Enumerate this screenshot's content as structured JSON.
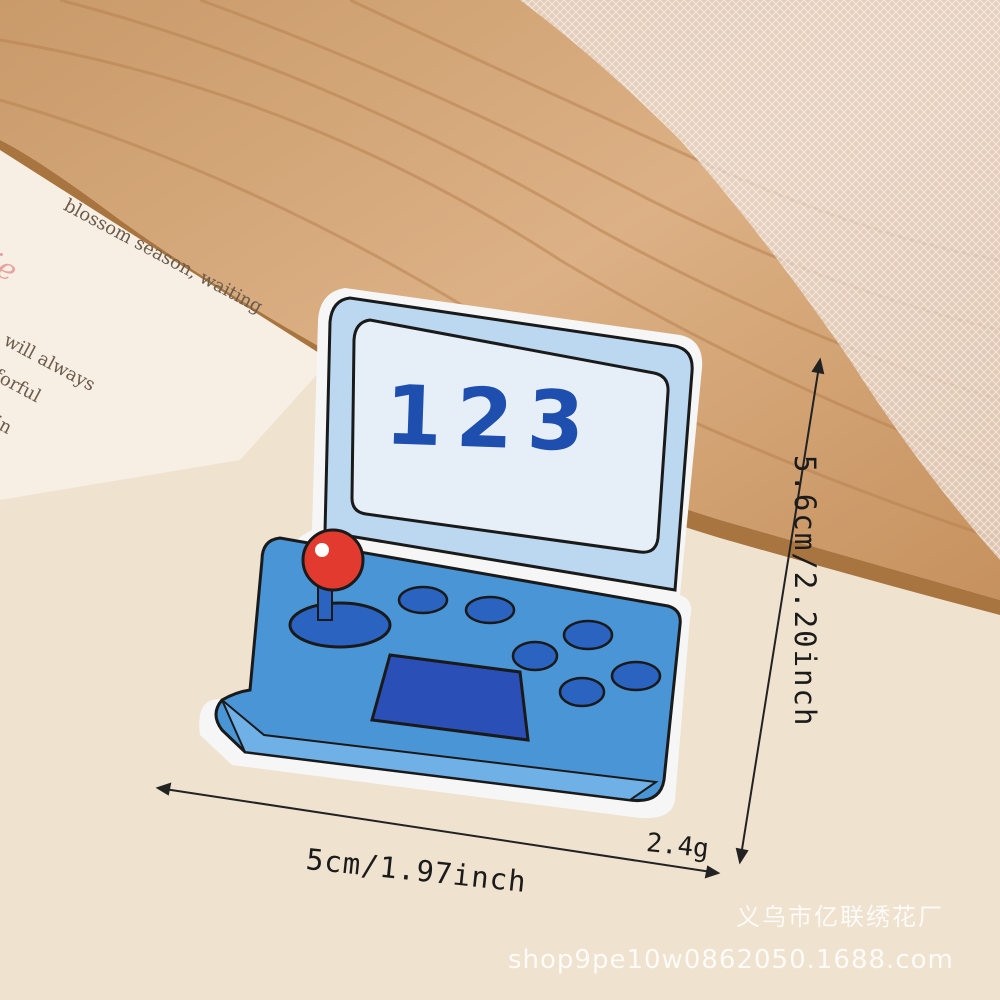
{
  "product": {
    "screen_number": "123",
    "width_label": "5cm/1.97inch",
    "height_label": "5.6cm/2.20inch",
    "weight_label": "2.4g"
  },
  "watermark": {
    "shop_name": "义乌市亿联绣花厂",
    "shop_url": "shop9pe10w0862050.1688.com"
  },
  "background_card": {
    "line1": "blossom season, waiting",
    "line2": "tie",
    "line3": "will always",
    "line4": "forful",
    "line5": "in"
  },
  "colors": {
    "wood": "#d6a878",
    "patch_light_blue": "#bcd8f0",
    "patch_body_blue": "#4a95d6",
    "number_blue": "#1f4fae",
    "joystick_red": "#e23a2e"
  }
}
